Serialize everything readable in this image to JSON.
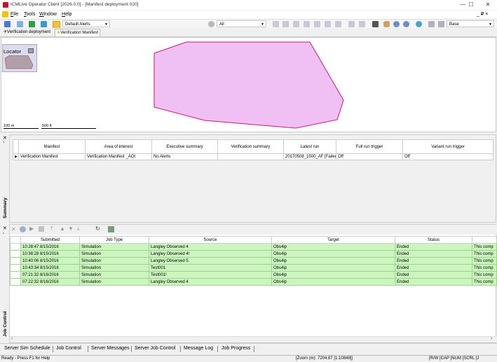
{
  "window": {
    "title": "ICMLive Operator Client [2026.0.0] - [Manifest deployment 020]",
    "controls": [
      "—",
      "☐",
      "✕"
    ],
    "mdi_controls": "_ ₽ ×"
  },
  "menu": {
    "items": [
      {
        "label": "File",
        "accel": "F",
        "rest": "ile"
      },
      {
        "label": "Tools",
        "accel": "T",
        "rest": "ools"
      },
      {
        "label": "Window",
        "accel": "W",
        "rest": "indow"
      },
      {
        "label": "Help",
        "accel": "H",
        "rest": "elp"
      }
    ]
  },
  "toolbar": {
    "alerts_combo": "Default Alerts",
    "filter_combo": "All",
    "base_combo": "Base"
  },
  "doc_tabs": [
    {
      "label": "Verification deployment"
    },
    {
      "label": "Verification Manifest"
    }
  ],
  "map": {
    "locator_title": "Locator",
    "polygon_fill": "#f0c0f5",
    "polygon_stroke": "#d0186c",
    "scale_m": "100 m",
    "scale_ft": "500 ft"
  },
  "summary": {
    "side_label": "Summary",
    "columns": [
      "Manifest",
      "Area of interest",
      "Executive summary",
      "Verification summary",
      "Latest run",
      "Full run trigger",
      "Variant run trigger"
    ],
    "rows": [
      [
        "Verification Manifest",
        "Verification Manifest _AOI",
        "No Alerts",
        "",
        "20170508_1500_AF [Failed /",
        "Off",
        "Off"
      ]
    ]
  },
  "job_control": {
    "side_label": "Job Control",
    "columns": [
      "Submitted",
      "Job Type",
      "Source",
      "Target",
      "Status",
      ""
    ],
    "rows": [
      [
        "10:28:47 8/15/2016",
        "Simulation",
        "Langley Observed 4",
        "Obs4ip",
        "Ended",
        "This comp"
      ],
      [
        "10:38:28 8/15/2016",
        "Simulation",
        "Langley Observed 4!",
        "Obs4ip",
        "Ended",
        "This comp"
      ],
      [
        "10:40:06 8/15/2016",
        "Simulation",
        "Langley Observed 5",
        "Obs4ip",
        "Ended",
        "This comp"
      ],
      [
        "10:43:34 8/15/2016",
        "Simulation",
        "Test001",
        "Obs4ip",
        "Ended",
        "This comp"
      ],
      [
        "07:21:32 8/16/2016",
        "Simulation",
        "Test001!",
        "Obs4ip",
        "Ended",
        "This comp"
      ],
      [
        "07:22:32 8/16/2016",
        "Simulation",
        "Langley Observed 4",
        "Obs4ip",
        "Ended",
        "This comp"
      ]
    ]
  },
  "bottom_tabs": [
    {
      "label": "Server Sim Schedule"
    },
    {
      "label": "Job Control"
    },
    {
      "label": "Server Messages"
    },
    {
      "label": "Server Job Control"
    },
    {
      "label": "Message Log"
    },
    {
      "label": "Job Progress"
    }
  ],
  "status": {
    "help": "Ready - Press F1 for Help",
    "zoom": "[Zoom (m): 7204.87 [1:10849]]",
    "flags": "[R/W  [CAP [NUM [SCRL [J"
  }
}
